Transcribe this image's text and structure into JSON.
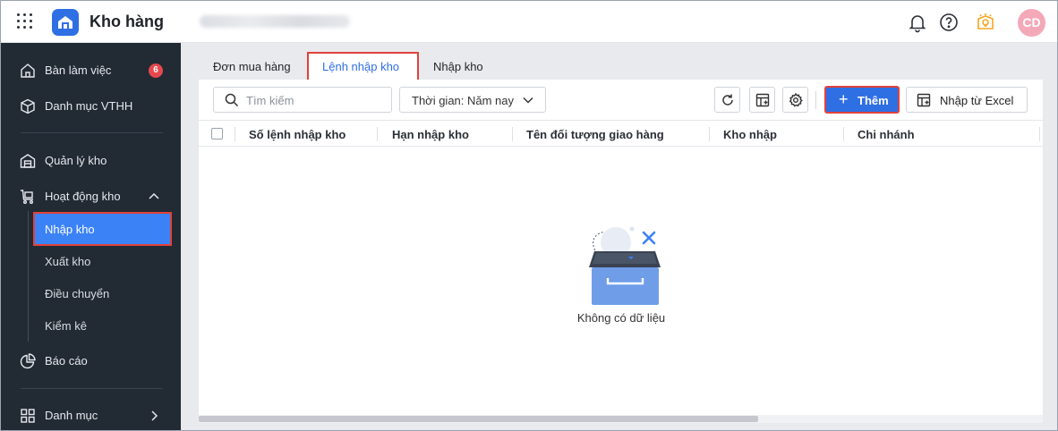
{
  "app": {
    "title": "Kho hàng",
    "avatar_initials": "CD",
    "icons": [
      "apps-grid-icon",
      "warehouse-logo-icon",
      "bell-icon",
      "help-icon",
      "lightbulb-icon"
    ]
  },
  "sidebar": {
    "items": [
      {
        "label": "Bàn làm việc",
        "badge": "6",
        "icon": "home-icon"
      },
      {
        "label": "Danh mục VTHH",
        "icon": "box-icon"
      },
      {
        "label": "Quản lý kho",
        "icon": "warehouse-icon"
      },
      {
        "label": "Hoạt động kho",
        "icon": "cart-icon",
        "expanded": true
      },
      {
        "label": "Báo cáo",
        "icon": "pie-chart-icon"
      },
      {
        "label": "Danh mục",
        "icon": "grid-icon"
      }
    ],
    "sub_items": [
      {
        "label": "Nhập kho",
        "active": true
      },
      {
        "label": "Xuất kho"
      },
      {
        "label": "Điều chuyển"
      },
      {
        "label": "Kiểm kê"
      }
    ]
  },
  "tabs": [
    {
      "label": "Đơn mua hàng"
    },
    {
      "label": "Lệnh nhập kho",
      "active": true
    },
    {
      "label": "Nhập kho"
    }
  ],
  "toolbar": {
    "search_placeholder": "Tìm kiếm",
    "time_filter": "Thời gian: Năm nay",
    "add_label": "Thêm",
    "excel_label": "Nhập từ Excel"
  },
  "table": {
    "columns": [
      "Số lệnh nhập kho",
      "Hạn nhập kho",
      "Tên đối tượng giao hàng",
      "Kho nhập",
      "Chi nhánh"
    ],
    "rows": [],
    "empty_text": "Không có dữ liệu"
  },
  "colors": {
    "primary": "#2f6fe4",
    "sidebar_bg": "#222a34",
    "highlight_border": "#e0423a",
    "badge": "#e5484d"
  }
}
